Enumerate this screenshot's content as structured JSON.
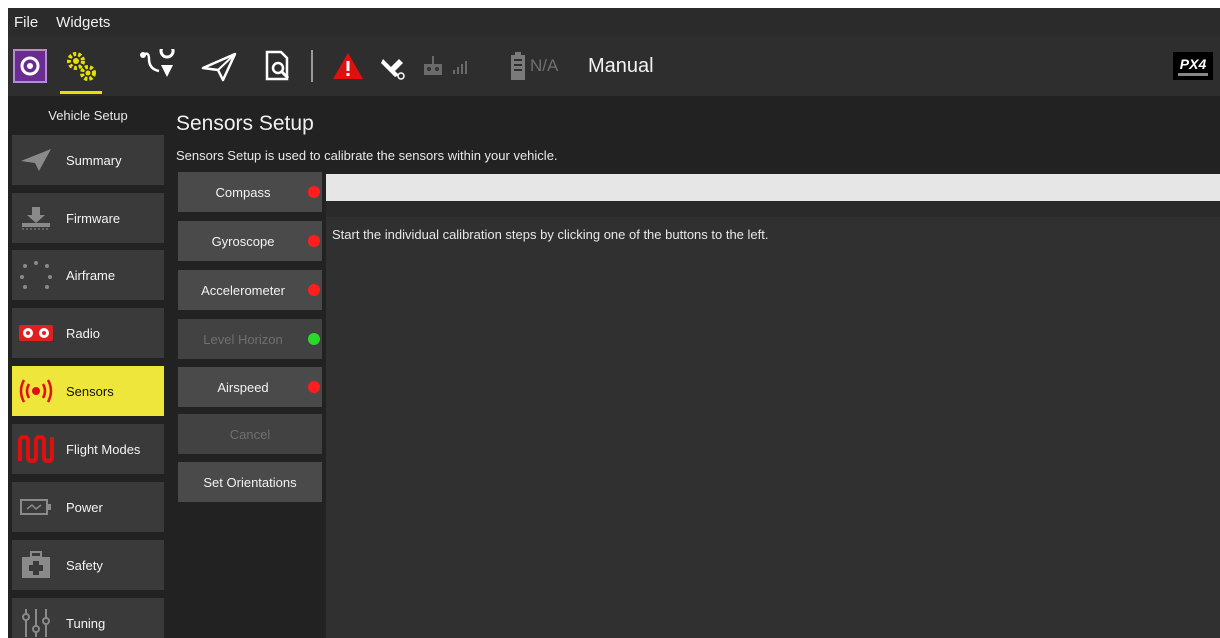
{
  "menu": {
    "file": "File",
    "widgets": "Widgets"
  },
  "toolbar": {
    "battery_text": "N/A",
    "flight_mode": "Manual",
    "logo_text": "PX4",
    "icons": [
      "qgc-logo-icon",
      "settings-gears-icon",
      "plan-icon",
      "fly-icon",
      "analyze-icon",
      "warning-icon",
      "gps-icon",
      "rc-transmitter-icon",
      "signal-icon",
      "battery-icon"
    ],
    "colors": {
      "accent": "#e8e000",
      "warning": "#e01010",
      "qgc_purple": "#6b2c91"
    }
  },
  "sidebar": {
    "title": "Vehicle Setup",
    "items": [
      {
        "label": "Summary",
        "icon": "paper-plane-icon"
      },
      {
        "label": "Firmware",
        "icon": "download-icon"
      },
      {
        "label": "Airframe",
        "icon": "airframe-icon"
      },
      {
        "label": "Radio",
        "icon": "radio-icon"
      },
      {
        "label": "Sensors",
        "icon": "sensors-icon",
        "active": true
      },
      {
        "label": "Flight Modes",
        "icon": "flight-modes-icon"
      },
      {
        "label": "Power",
        "icon": "power-icon"
      },
      {
        "label": "Safety",
        "icon": "safety-icon"
      },
      {
        "label": "Tuning",
        "icon": "tuning-icon"
      }
    ]
  },
  "main": {
    "title": "Sensors Setup",
    "description": "Sensors Setup is used to calibrate the sensors within your vehicle.",
    "buttons": [
      {
        "label": "Compass",
        "status": "red"
      },
      {
        "label": "Gyroscope",
        "status": "red"
      },
      {
        "label": "Accelerometer",
        "status": "red"
      },
      {
        "label": "Level Horizon",
        "status": "green",
        "disabled": true
      },
      {
        "label": "Airspeed",
        "status": "red"
      },
      {
        "label": "Cancel",
        "disabled": true
      },
      {
        "label": "Set Orientations"
      }
    ],
    "status_text": "Start the individual calibration steps by clicking one of the buttons to the left."
  }
}
